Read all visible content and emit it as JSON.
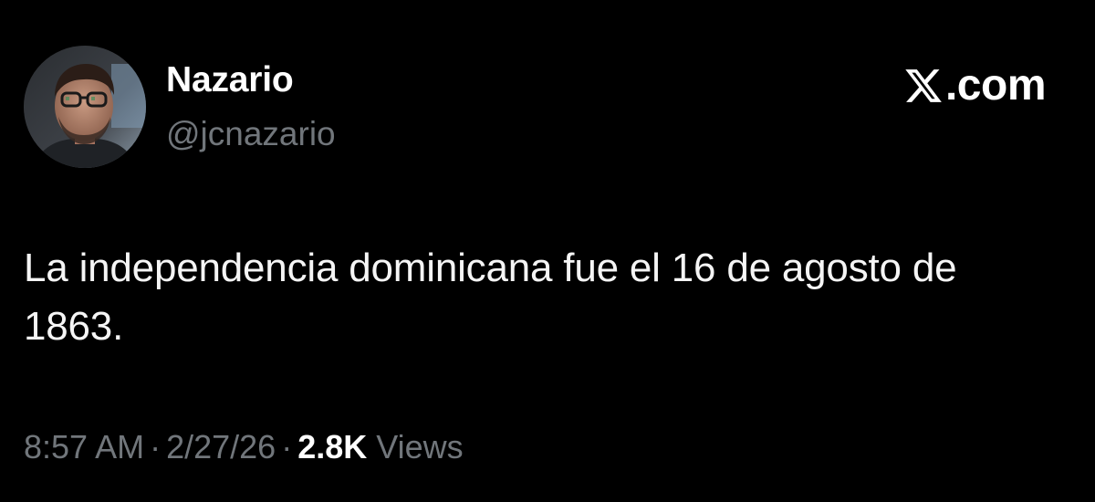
{
  "author": {
    "display_name": "Nazario",
    "handle": "@jcnazario",
    "avatar": "profile-photo-man-with-glasses"
  },
  "brand": {
    "icon": "x-logo",
    "label": ".com"
  },
  "tweet": {
    "text": "La independencia dominicana fue el 16 de agosto de 1863."
  },
  "meta": {
    "time": "8:57 AM",
    "separator": "·",
    "date": "2/27/26",
    "views_count": "2.8K",
    "views_label": "Views"
  },
  "colors": {
    "background": "#000000",
    "primary_text": "#ffffff",
    "secondary_text": "#71767b"
  }
}
